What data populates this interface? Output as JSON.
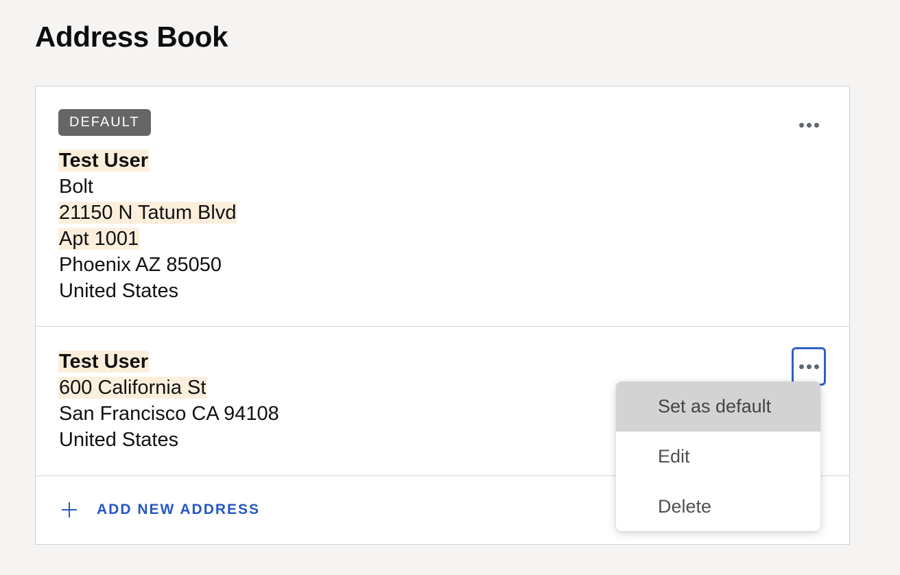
{
  "page": {
    "title": "Address Book"
  },
  "addresses": [
    {
      "badge": "DEFAULT",
      "name": "Test User",
      "company": "Bolt",
      "street": "21150 N Tatum Blvd",
      "unit": "Apt 1001",
      "city_line": "Phoenix AZ 85050",
      "country": "United States"
    },
    {
      "name": "Test User",
      "street": "600 California St",
      "city_line": "San Francisco CA 94108",
      "country": "United States"
    }
  ],
  "add_address": {
    "icon": "plus-icon",
    "label": "ADD NEW ADDRESS"
  },
  "menu": {
    "icon": "more-horizontal-icon",
    "items": [
      {
        "label": "Set as default",
        "highlighted": true
      },
      {
        "label": "Edit",
        "highlighted": false
      },
      {
        "label": "Delete",
        "highlighted": false
      }
    ]
  },
  "colors": {
    "background": "#f5f4f2",
    "card": "#ffffff",
    "accent": "#2658c2",
    "badge": "#666666",
    "text_highlight": "#fbefdc",
    "menu_highlight": "#d3d3d3"
  }
}
